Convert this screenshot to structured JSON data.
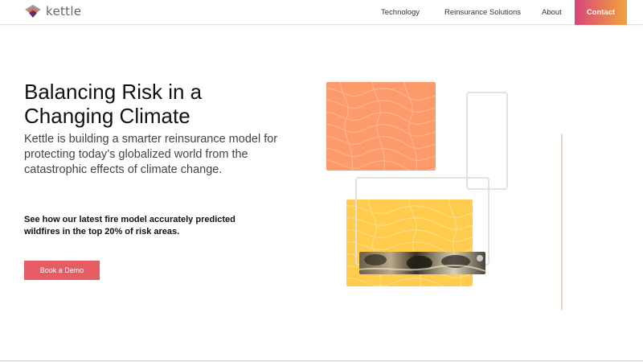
{
  "header": {
    "logo_text": "kettle",
    "logo_icon": "layers-icon",
    "nav": [
      {
        "label": "Technology"
      },
      {
        "label": "Reinsurance Solutions"
      },
      {
        "label": "About"
      }
    ],
    "contact_label": "Contact"
  },
  "hero": {
    "title": "Balancing Risk in a Changing Climate",
    "subtitle": "Kettle is building a smarter reinsurance model for protecting today’s globalized world from the catastrophic effects of climate change.",
    "callout": "See how our latest fire model accurately predicted wildfires in the top 20% of risk areas.",
    "cta_label": "Book a Demo"
  },
  "colors": {
    "accent": "#e65c64",
    "contact_gradient_start": "#d8457a",
    "contact_gradient_end": "#f0a43e",
    "tile_orange": "#fd9a6b",
    "tile_yellow": "#ffcc4d"
  }
}
